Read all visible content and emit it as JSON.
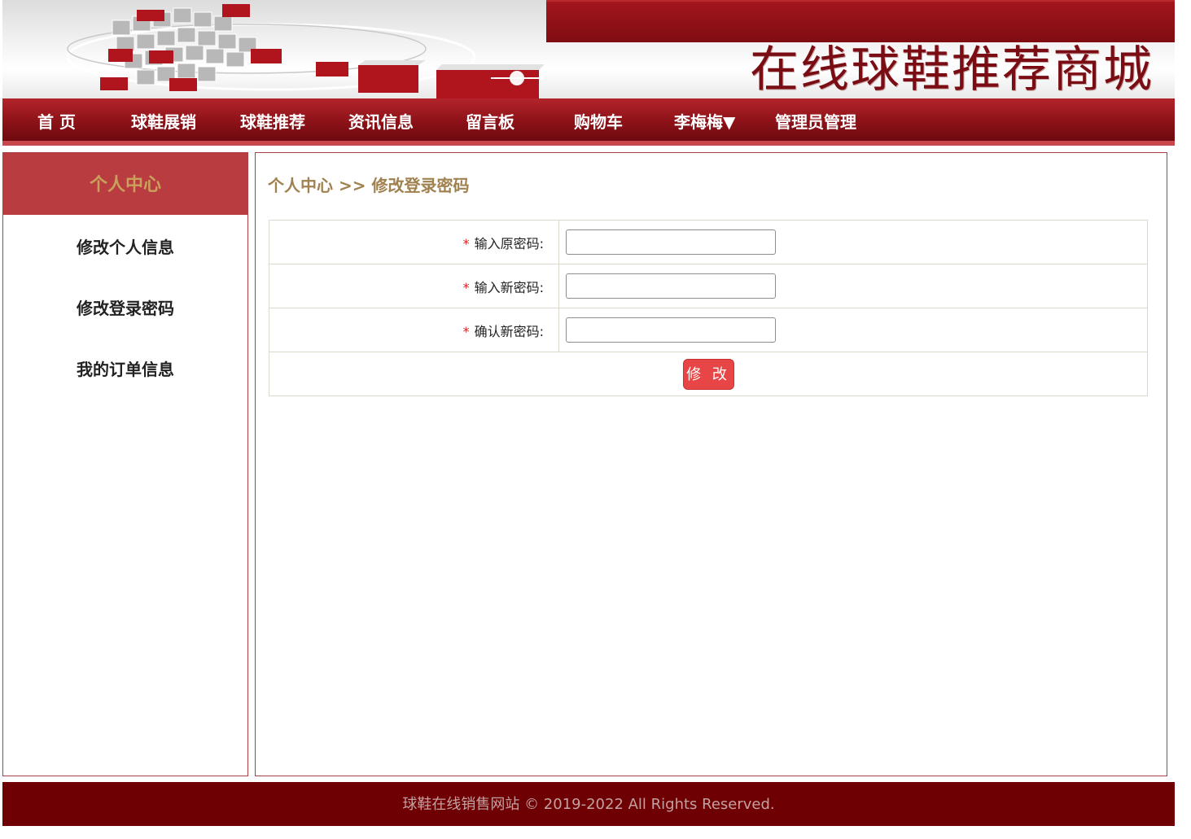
{
  "site": {
    "title": "在线球鞋推荐商城"
  },
  "nav": {
    "items": [
      {
        "label": "首 页"
      },
      {
        "label": "球鞋展销"
      },
      {
        "label": "球鞋推荐"
      },
      {
        "label": "资讯信息"
      },
      {
        "label": "留言板"
      },
      {
        "label": "购物车"
      },
      {
        "label": "李梅梅▼"
      },
      {
        "label": "管理员管理"
      }
    ]
  },
  "sidebar": {
    "heading": "个人中心",
    "items": [
      {
        "label": "修改个人信息"
      },
      {
        "label": "修改登录密码"
      },
      {
        "label": "我的订单信息"
      }
    ]
  },
  "main": {
    "breadcrumb": "个人中心 >> 修改登录密码",
    "form": {
      "required_mark": "*",
      "fields": [
        {
          "label": "输入原密码:",
          "value": ""
        },
        {
          "label": "输入新密码:",
          "value": ""
        },
        {
          "label": "确认新密码:",
          "value": ""
        }
      ],
      "submit_label": "修 改"
    }
  },
  "footer": {
    "text": "球鞋在线销售网站 © 2019-2022 All Rights Reserved."
  },
  "colors": {
    "brand_red": "#8c1218",
    "footer_bg": "#6e0003",
    "accent_gold": "#a0814f",
    "button_red": "#e84646"
  }
}
